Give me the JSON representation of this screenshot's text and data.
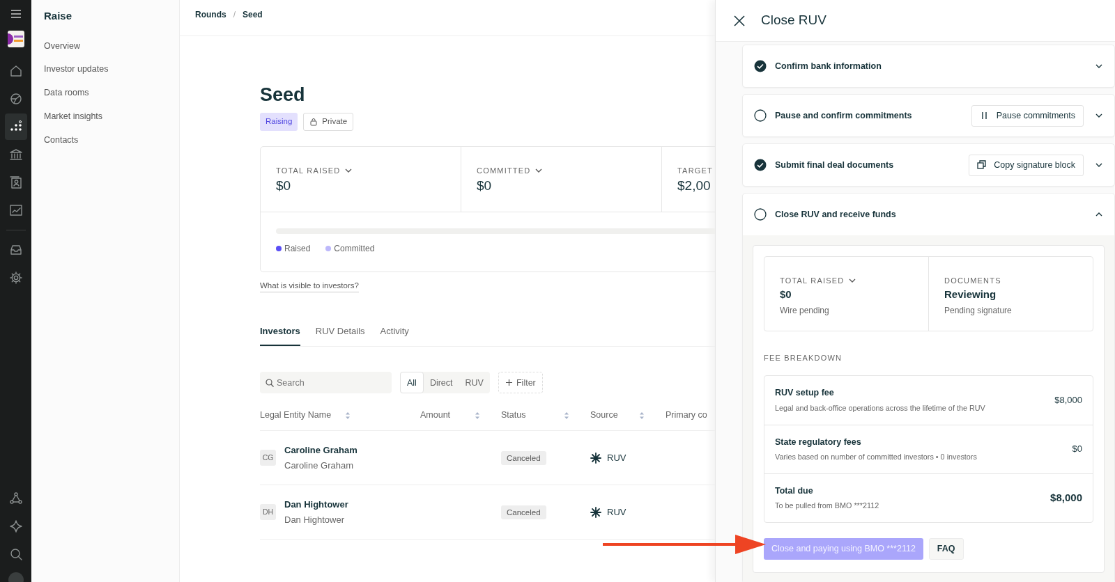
{
  "rail": {
    "items": [
      {
        "kind": "home",
        "selected": false
      },
      {
        "kind": "pie",
        "selected": false
      },
      {
        "kind": "dots",
        "selected": true
      },
      {
        "kind": "bank",
        "selected": false
      },
      {
        "kind": "contact",
        "selected": false
      },
      {
        "kind": "chart",
        "selected": false
      },
      {
        "kind": "inbox",
        "selected": false
      },
      {
        "kind": "gear",
        "selected": false
      }
    ],
    "bottom_items": [
      {
        "kind": "network",
        "selected": false
      },
      {
        "kind": "sparkle",
        "selected": false
      },
      {
        "kind": "search",
        "selected": false
      }
    ]
  },
  "sidebar": {
    "title": "Raise",
    "items": [
      {
        "label": "Overview"
      },
      {
        "label": "Investor updates"
      },
      {
        "label": "Data rooms"
      },
      {
        "label": "Market insights"
      },
      {
        "label": "Contacts"
      }
    ]
  },
  "breadcrumb": {
    "items": [
      "Rounds",
      "Seed"
    ],
    "separator": "/"
  },
  "round": {
    "title": "Seed",
    "status": "Raising",
    "visibility": "Private"
  },
  "stats": [
    {
      "label": "TOTAL RAISED",
      "value": "$0",
      "dropdown": true
    },
    {
      "label": "COMMITTED",
      "value": "$0",
      "dropdown": true
    },
    {
      "label": "TARGET",
      "value": "$2,00",
      "dropdown": false
    }
  ],
  "progress": {
    "level": 0,
    "legend": [
      {
        "label": "Raised",
        "color": "#5b4ff5"
      },
      {
        "label": "Committed",
        "color": "#bdb8fb"
      }
    ]
  },
  "visibility_link": "What is visible to investors?",
  "tabs": [
    {
      "label": "Investors",
      "selected": true
    },
    {
      "label": "RUV Details",
      "selected": false
    },
    {
      "label": "Activity",
      "selected": false
    }
  ],
  "search": {
    "placeholder": "Search"
  },
  "segments": [
    {
      "label": "All",
      "selected": true
    },
    {
      "label": "Direct",
      "selected": false
    },
    {
      "label": "RUV",
      "selected": false
    }
  ],
  "filter_button": "Filter",
  "table": {
    "columns": [
      {
        "label": "Legal Entity Name",
        "sortable": true
      },
      {
        "label": "Amount",
        "sortable": true
      },
      {
        "label": "Status",
        "sortable": true
      },
      {
        "label": "Source",
        "sortable": true
      },
      {
        "label": "Primary co",
        "sortable": false
      }
    ],
    "rows": [
      {
        "initials": "CG",
        "name": "Caroline Graham",
        "entity": "Caroline Graham",
        "status": "Canceled",
        "source": "RUV"
      },
      {
        "initials": "DH",
        "name": "Dan Hightower",
        "entity": "Dan Hightower",
        "status": "Canceled",
        "source": "RUV"
      }
    ]
  },
  "panel": {
    "title": "Close RUV",
    "steps": [
      {
        "label": "Confirm bank information",
        "done": true,
        "expanded": false
      },
      {
        "label": "Pause and confirm commitments",
        "done": false,
        "expanded": false,
        "action": {
          "kind": "pause",
          "label": "Pause commitments"
        }
      },
      {
        "label": "Submit final deal documents",
        "done": true,
        "expanded": false,
        "action": {
          "kind": "copy",
          "label": "Copy signature block"
        }
      },
      {
        "label": "Close RUV and receive funds",
        "done": false,
        "expanded": true
      }
    ],
    "summary": [
      {
        "label": "TOTAL RAISED",
        "value": "$0",
        "note": "Wire pending",
        "dropdown": true
      },
      {
        "label": "DOCUMENTS",
        "value": "Reviewing",
        "note": "Pending signature",
        "dropdown": false
      }
    ],
    "fee_heading": "FEE BREAKDOWN",
    "fees": [
      {
        "kind": "line",
        "name": "RUV setup fee",
        "description": "Legal and back-office operations across the lifetime of the RUV",
        "amount": "$8,000"
      },
      {
        "kind": "line",
        "name": "State regulatory fees",
        "description": "Varies based on number of committed investors • 0 investors",
        "amount": "$0"
      },
      {
        "kind": "total",
        "name": "Total due",
        "description": "To be pulled from BMO ***2112",
        "amount": "$8,000"
      }
    ],
    "primary_button": {
      "label": "Close and paying using BMO ***2112",
      "disabled": true
    },
    "faq_button": "FAQ"
  }
}
